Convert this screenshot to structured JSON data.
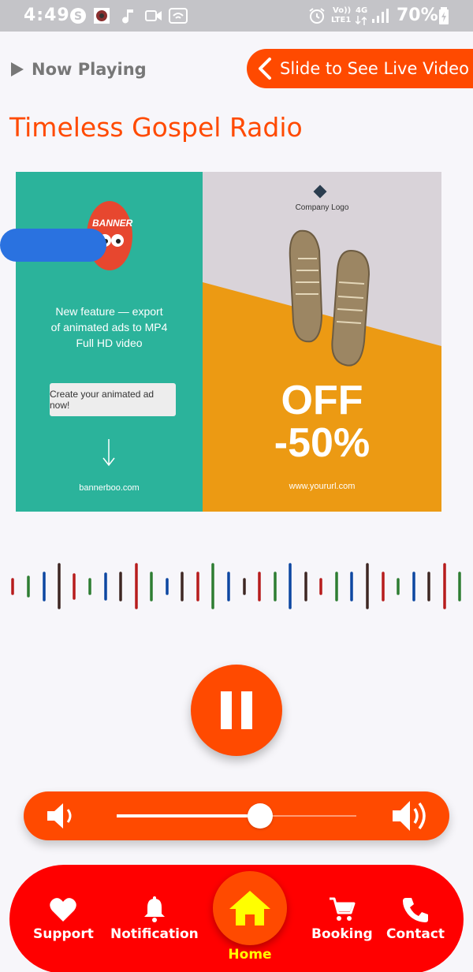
{
  "status_bar": {
    "time": "4:49",
    "volte": "Vo))",
    "lte": "LTE1",
    "network": "4G",
    "battery": "70%"
  },
  "header": {
    "now_playing": "Now Playing",
    "slide_label": "Slide to See Live Video"
  },
  "station": {
    "title": "Timeless Gospel Radio"
  },
  "ad": {
    "logo_text": "BANNER",
    "feature_line1": "New feature — export",
    "feature_line2": "of animated ads to MP4",
    "feature_line3": "Full HD video",
    "cta": "Create your animated ad now!",
    "left_url": "bannerboo.com",
    "company_logo": "Company Logo",
    "off": "OFF",
    "discount": "-50%",
    "right_url": "www.yoururl.com"
  },
  "player": {
    "state": "playing",
    "volume": 0.6
  },
  "colors": {
    "accent": "#ff4a00",
    "nav_bg": "#ff0000",
    "home_label": "#ffff00"
  },
  "nav": {
    "support": "Support",
    "notification": "Notification",
    "home": "Home",
    "booking": "Booking",
    "contact": "Contact"
  }
}
